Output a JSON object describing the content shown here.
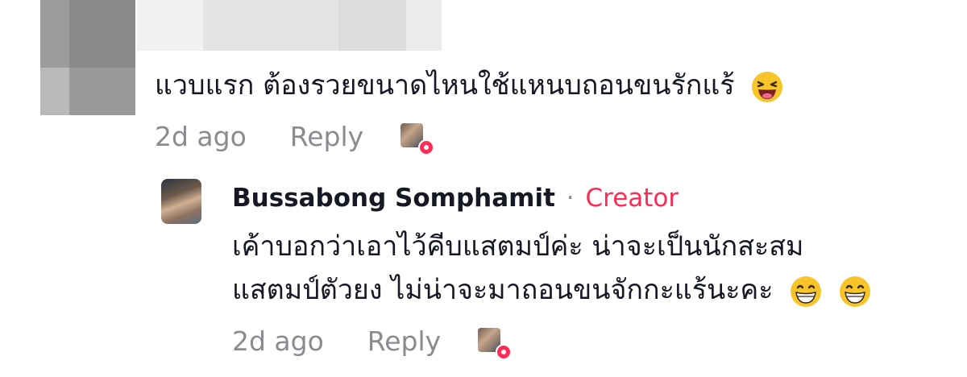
{
  "comment": {
    "text": "แวบแรก ต้องรวยขนาดไหนใช้แหนบถอนขนรักแร้",
    "emoji": "laughing-face-emoji",
    "time": "2d ago",
    "reply_label": "Reply"
  },
  "reply": {
    "author": "Bussabong Somphamit",
    "separator": "·",
    "badge": "Creator",
    "line1": "เค้าบอกว่าเอาไว้คีบแสตมป์ค่ะ น่าจะเป็นนักสะสม",
    "line2": "แสตมป์ตัวยง ไม่น่าจะมาถอนขนจักกะแร้นะคะ",
    "emojis": [
      "grinning-face-emoji",
      "grinning-face-emoji"
    ],
    "time": "2d ago",
    "reply_label": "Reply"
  },
  "colors": {
    "accent": "#fe2c55",
    "meta": "#8a8b91",
    "text": "#161823"
  }
}
